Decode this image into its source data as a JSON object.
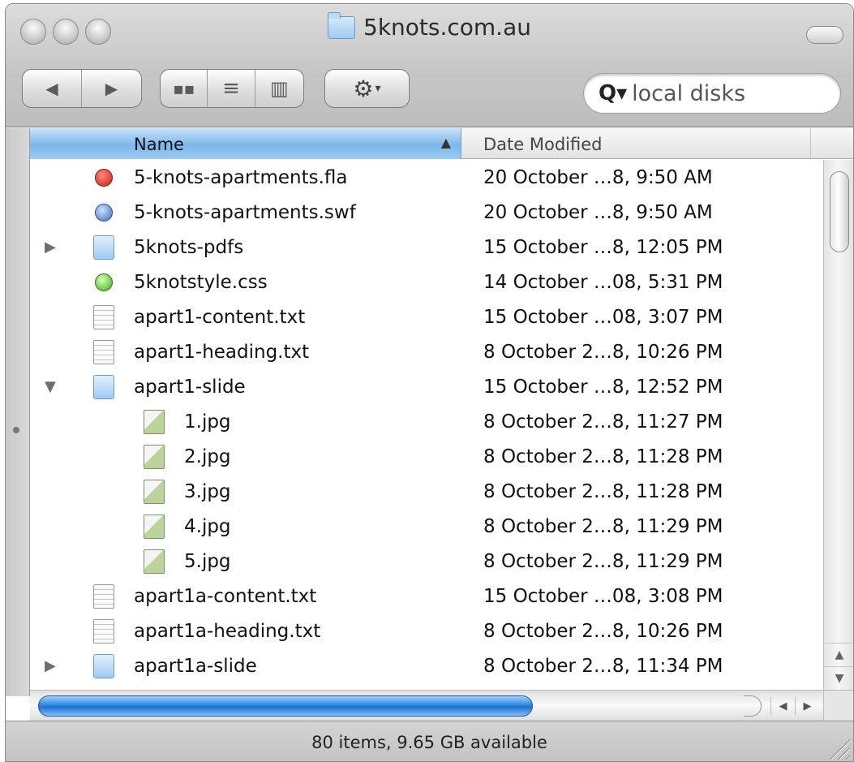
{
  "window": {
    "title": "5knots.com.au"
  },
  "toolbar": {
    "back_icon": "back-arrow-icon",
    "forward_icon": "forward-arrow-icon",
    "view_icons": [
      "icon-view-icon",
      "list-view-icon",
      "column-view-icon"
    ],
    "action_icon": "gear-icon",
    "search_placeholder": "local disks"
  },
  "list": {
    "columns": {
      "name": "Name",
      "date": "Date Modified"
    },
    "rows": [
      {
        "name": "5-knots-apartments.fla",
        "date": "20 October …8, 9:50 AM",
        "type": "fla",
        "disclosure": "",
        "indent": 0
      },
      {
        "name": "5-knots-apartments.swf",
        "date": "20 October …8, 9:50 AM",
        "type": "swf",
        "disclosure": "",
        "indent": 0
      },
      {
        "name": "5knots-pdfs",
        "date": "15 October …8, 12:05 PM",
        "type": "folder",
        "disclosure": "▶",
        "indent": 0
      },
      {
        "name": "5knotstyle.css",
        "date": "14 October …08, 5:31 PM",
        "type": "css",
        "disclosure": "",
        "indent": 0
      },
      {
        "name": "apart1-content.txt",
        "date": "15 October …08, 3:07 PM",
        "type": "doc",
        "disclosure": "",
        "indent": 0
      },
      {
        "name": "apart1-heading.txt",
        "date": "8 October 2…8, 10:26 PM",
        "type": "doc",
        "disclosure": "",
        "indent": 0
      },
      {
        "name": "apart1-slide",
        "date": "15 October …8, 12:52 PM",
        "type": "folder",
        "disclosure": "▼",
        "indent": 0
      },
      {
        "name": "1.jpg",
        "date": "8 October 2…8, 11:27 PM",
        "type": "jpg",
        "disclosure": "",
        "indent": 1
      },
      {
        "name": "2.jpg",
        "date": "8 October 2…8, 11:28 PM",
        "type": "jpg",
        "disclosure": "",
        "indent": 1
      },
      {
        "name": "3.jpg",
        "date": "8 October 2…8, 11:28 PM",
        "type": "jpg",
        "disclosure": "",
        "indent": 1
      },
      {
        "name": "4.jpg",
        "date": "8 October 2…8, 11:29 PM",
        "type": "jpg",
        "disclosure": "",
        "indent": 1
      },
      {
        "name": "5.jpg",
        "date": "8 October 2…8, 11:29 PM",
        "type": "jpg",
        "disclosure": "",
        "indent": 1
      },
      {
        "name": "apart1a-content.txt",
        "date": "15 October …08, 3:08 PM",
        "type": "doc",
        "disclosure": "",
        "indent": 0
      },
      {
        "name": "apart1a-heading.txt",
        "date": "8 October 2…8, 10:26 PM",
        "type": "doc",
        "disclosure": "",
        "indent": 0
      },
      {
        "name": "apart1a-slide",
        "date": "8 October 2…8, 11:34 PM",
        "type": "folder",
        "disclosure": "▶",
        "indent": 0
      }
    ]
  },
  "status": {
    "text": "80 items, 9.65 GB available"
  },
  "colors": {
    "selected_column": "#7db7ea",
    "scroll_thumb": "#2f87e2",
    "chrome": "#c6c6c6"
  }
}
